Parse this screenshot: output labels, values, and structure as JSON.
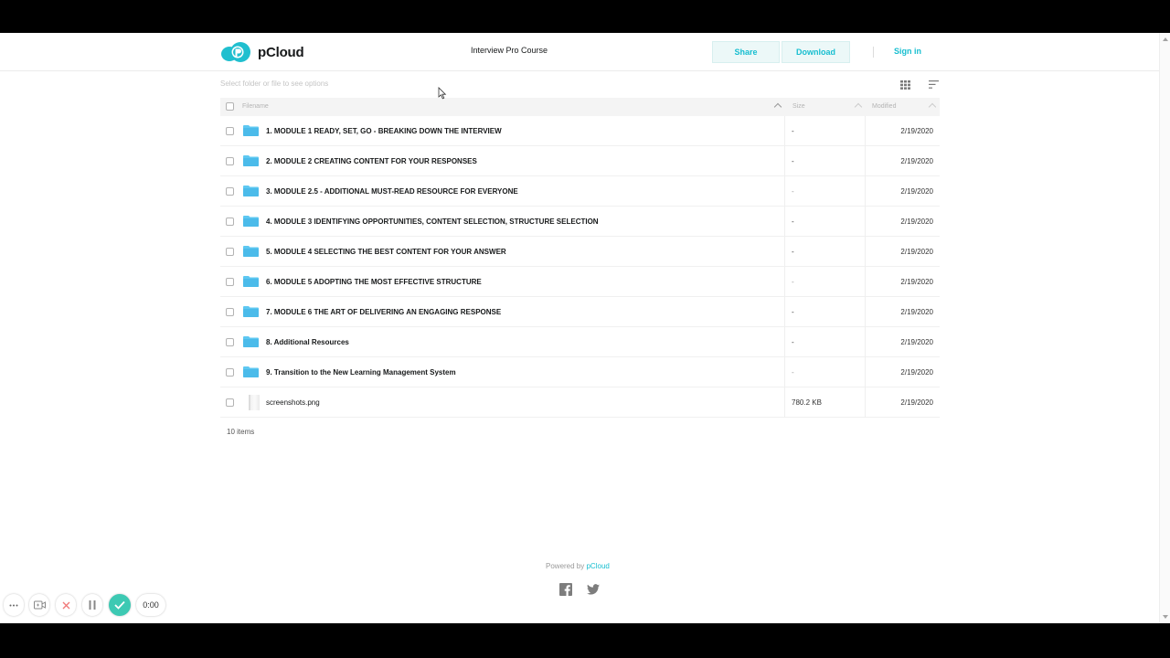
{
  "header": {
    "brand": "pCloud",
    "folder_title": "Interview Pro Course",
    "share_label": "Share",
    "download_label": "Download",
    "signin_label": "Sign in"
  },
  "toolbar": {
    "hint": "Select folder or file to see options",
    "grid_icon": "grid-view-icon",
    "sort_icon": "sort-icon"
  },
  "table": {
    "headers": {
      "filename": "Filename",
      "size": "Size",
      "modified": "Modified"
    },
    "rows": [
      {
        "name": "1. MODULE 1 READY, SET, GO - BREAKING DOWN THE INTERVIEW",
        "size": "-",
        "modified": "2/19/2020"
      },
      {
        "name": "2. MODULE 2 CREATING CONTENT FOR YOUR RESPONSES",
        "size": "-",
        "modified": "2/19/2020"
      },
      {
        "name": "3. MODULE 2.5 - ADDITIONAL MUST-READ RESOURCE FOR EVERYONE",
        "size": "-",
        "modified": "2/19/2020"
      },
      {
        "name": "4. MODULE 3 IDENTIFYING OPPORTUNITIES, CONTENT SELECTION, STRUCTURE SELECTION",
        "size": "-",
        "modified": "2/19/2020"
      },
      {
        "name": "5. MODULE 4 SELECTING THE BEST CONTENT FOR YOUR ANSWER",
        "size": "-",
        "modified": "2/19/2020"
      },
      {
        "name": "6. MODULE 5 ADOPTING THE MOST EFFECTIVE STRUCTURE",
        "size": "-",
        "modified": "2/19/2020"
      },
      {
        "name": "7. MODULE 6 THE ART OF DELIVERING AN ENGAGING RESPONSE",
        "size": "-",
        "modified": "2/19/2020"
      },
      {
        "name": "8. Additional Resources",
        "size": "-",
        "modified": "2/19/2020"
      },
      {
        "name": "9. Transition to the New Learning Management System",
        "size": "-",
        "modified": "2/19/2020"
      },
      {
        "name": "screenshots.png",
        "size": "780.2 KB",
        "modified": "2/19/2020"
      }
    ],
    "count_label": "10 items"
  },
  "footer": {
    "powered_prefix": "Powered by",
    "powered_brand": "pCloud"
  },
  "recorder": {
    "timer": "0:00"
  },
  "colors": {
    "accent": "#17bed0",
    "folder": "#5ec8f2",
    "record_done": "#3dc9b3"
  }
}
